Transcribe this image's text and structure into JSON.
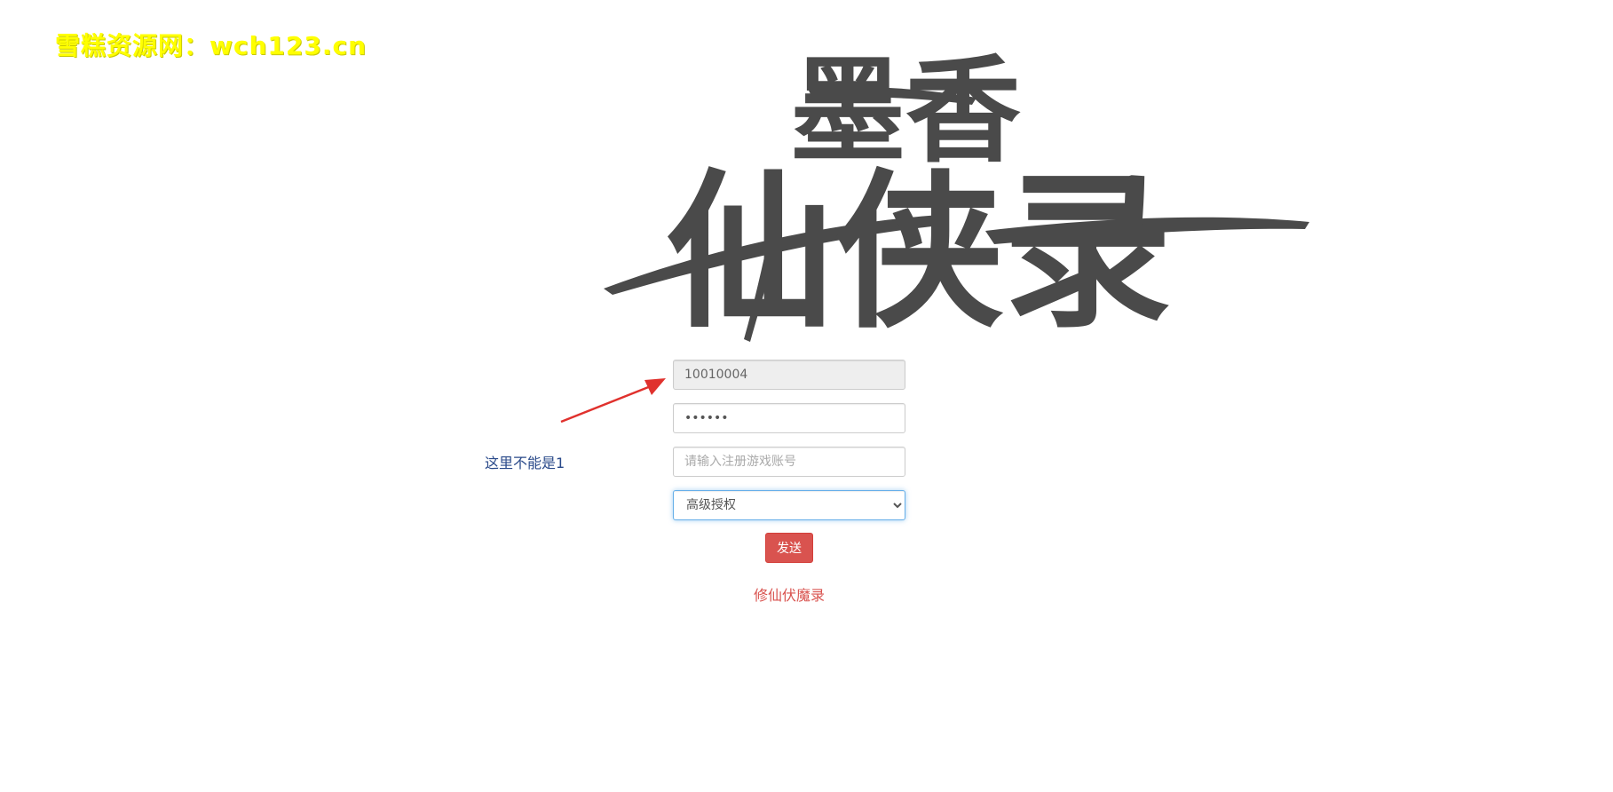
{
  "watermark": {
    "text": "雪糕资源网：wch123.cn"
  },
  "logo": {
    "line1": "墨香",
    "line2": "仙侠录",
    "color": "#4a4a4a"
  },
  "form": {
    "account_value": "10010004",
    "password_value": "••••••",
    "register_placeholder": "请输入注册游戏账号",
    "auth_options": [
      "高级授权"
    ],
    "auth_selected": "高级授权",
    "send_label": "发送"
  },
  "annotation": {
    "note": "这里不能是1",
    "arrow_color": "#e0312d"
  },
  "footer": {
    "link_text": "修仙伏魔录"
  },
  "colors": {
    "send_button": "#d9534f",
    "link": "#d9534f",
    "note": "#2a4a8a",
    "watermark": "#ffff00"
  }
}
